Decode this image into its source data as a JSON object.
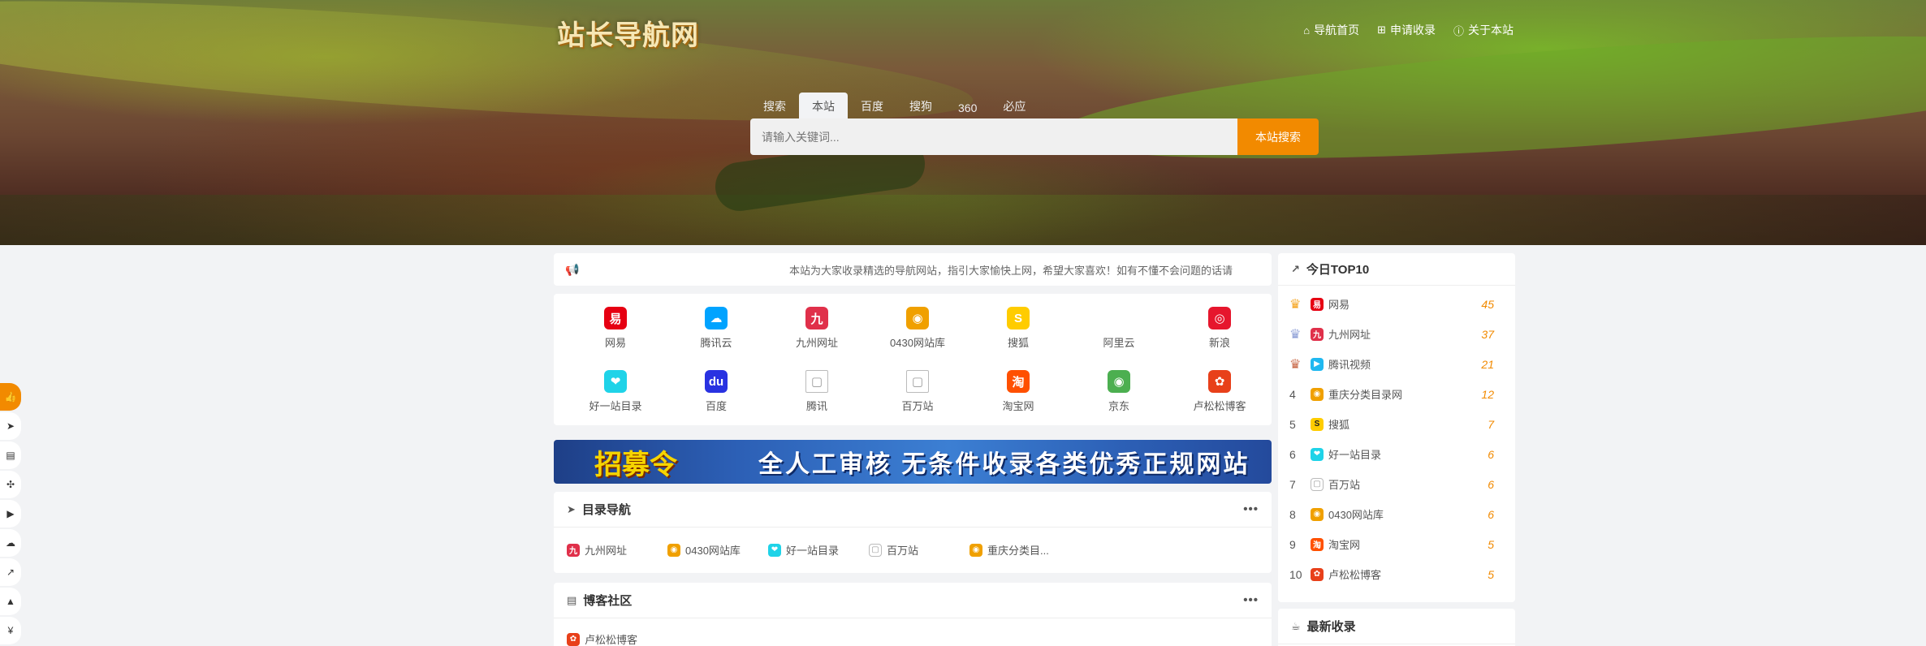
{
  "header": {
    "logo": "站长导航网",
    "nav": [
      {
        "icon": "home-icon",
        "glyph": "⌂",
        "label": "导航首页"
      },
      {
        "icon": "plus-square-icon",
        "glyph": "⊞",
        "label": "申请收录"
      },
      {
        "icon": "info-icon",
        "glyph": "ⓘ",
        "label": "关于本站"
      }
    ]
  },
  "search": {
    "tabs": [
      "搜索",
      "本站",
      "百度",
      "搜狗",
      "360",
      "必应"
    ],
    "active_tab": "本站",
    "placeholder": "请输入关键词...",
    "button": "本站搜索"
  },
  "notice": {
    "text": "本站为大家收录精选的导航网站，指引大家愉快上网，希望大家喜欢！如有不懂不会问题的话请"
  },
  "sites": [
    {
      "name": "网易",
      "color": "#e60012",
      "glyph": "易"
    },
    {
      "name": "腾讯云",
      "color": "#00a3ff",
      "glyph": "☁"
    },
    {
      "name": "九州网址",
      "color": "#e0304a",
      "glyph": "九"
    },
    {
      "name": "0430网站库",
      "color": "#f0a000",
      "glyph": "◉"
    },
    {
      "name": "搜狐",
      "color": "#ffcc00",
      "glyph": "S"
    },
    {
      "name": "阿里云",
      "color": "#ffffff",
      "glyph": ""
    },
    {
      "name": "新浪",
      "color": "#e6162d",
      "glyph": "◎"
    },
    {
      "name": "好一站目录",
      "color": "#1fd3e8",
      "glyph": "❤"
    },
    {
      "name": "百度",
      "color": "#2932e1",
      "glyph": "du"
    },
    {
      "name": "腾讯",
      "color": "#cccccc",
      "glyph": "▢"
    },
    {
      "name": "百万站",
      "color": "#cccccc",
      "glyph": "▢"
    },
    {
      "name": "淘宝网",
      "color": "#ff5000",
      "glyph": "淘"
    },
    {
      "name": "京东",
      "color": "#4caf50",
      "glyph": "◉"
    },
    {
      "name": "卢松松博客",
      "color": "#e8401a",
      "glyph": "✿"
    }
  ],
  "banner": {
    "left": "招募令",
    "right": "全人工审核  无条件收录各类优秀正规网站"
  },
  "directory": {
    "title": "目录导航",
    "more": "•••",
    "items": [
      {
        "name": "九州网址",
        "color": "#e0304a",
        "glyph": "九"
      },
      {
        "name": "0430网站库",
        "color": "#f0a000",
        "glyph": "◉"
      },
      {
        "name": "好一站目录",
        "color": "#1fd3e8",
        "glyph": "❤"
      },
      {
        "name": "百万站",
        "color": "#cccccc",
        "glyph": "▢"
      },
      {
        "name": "重庆分类目...",
        "color": "#f0a000",
        "glyph": "◉"
      }
    ]
  },
  "blog": {
    "title": "博客社区",
    "more": "•••",
    "first_item": "卢松松博客"
  },
  "top10": {
    "title": "今日TOP10",
    "items": [
      {
        "rank": "1",
        "crown_color": "#f5a623",
        "name": "网易",
        "count": "45",
        "color": "#e60012",
        "glyph": "易"
      },
      {
        "rank": "2",
        "crown_color": "#8e9fd6",
        "name": "九州网址",
        "count": "37",
        "color": "#e0304a",
        "glyph": "九"
      },
      {
        "rank": "3",
        "crown_color": "#c96a4a",
        "name": "腾讯视频",
        "count": "21",
        "color": "#20b8f0",
        "glyph": "▶"
      },
      {
        "rank": "4",
        "name": "重庆分类目录网",
        "count": "12",
        "color": "#f0a000",
        "glyph": "◉"
      },
      {
        "rank": "5",
        "name": "搜狐",
        "count": "7",
        "color": "#ffcc00",
        "glyph": "S"
      },
      {
        "rank": "6",
        "name": "好一站目录",
        "count": "6",
        "color": "#1fd3e8",
        "glyph": "❤"
      },
      {
        "rank": "7",
        "name": "百万站",
        "count": "6",
        "color": "#cccccc",
        "glyph": "▢"
      },
      {
        "rank": "8",
        "name": "0430网站库",
        "count": "6",
        "color": "#f0a000",
        "glyph": "◉"
      },
      {
        "rank": "9",
        "name": "淘宝网",
        "count": "5",
        "color": "#ff5000",
        "glyph": "淘"
      },
      {
        "rank": "10",
        "name": "卢松松博客",
        "count": "5",
        "color": "#e8401a",
        "glyph": "✿"
      }
    ]
  },
  "latest": {
    "title": "最新收录"
  },
  "side_buttons": [
    {
      "icon": "thumbs-up-icon",
      "glyph": "👍",
      "active": true
    },
    {
      "icon": "paper-plane-icon",
      "glyph": "➤"
    },
    {
      "icon": "document-icon",
      "glyph": "▤"
    },
    {
      "icon": "gamepad-icon",
      "glyph": "✣"
    },
    {
      "icon": "video-icon",
      "glyph": "▶"
    },
    {
      "icon": "cloud-icon",
      "glyph": "☁"
    },
    {
      "icon": "chart-icon",
      "glyph": "↗"
    },
    {
      "icon": "graduation-icon",
      "glyph": "▲"
    },
    {
      "icon": "yen-icon",
      "glyph": "¥"
    }
  ]
}
